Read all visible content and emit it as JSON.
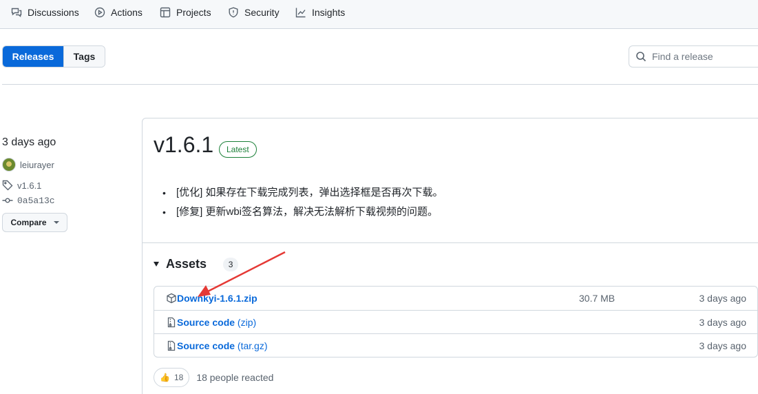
{
  "repo_nav": {
    "items": [
      {
        "label": "Discussions",
        "icon": "comment-discussion-icon"
      },
      {
        "label": "Actions",
        "icon": "play-icon"
      },
      {
        "label": "Projects",
        "icon": "table-icon"
      },
      {
        "label": "Security",
        "icon": "shield-icon"
      },
      {
        "label": "Insights",
        "icon": "graph-icon"
      }
    ]
  },
  "subnav": {
    "releases_label": "Releases",
    "tags_label": "Tags",
    "search_placeholder": "Find a release"
  },
  "sidebar": {
    "date": "3 days ago",
    "author": "leiurayer",
    "tag": "v1.6.1",
    "commit": "0a5a13c",
    "compare_label": "Compare"
  },
  "release": {
    "title": "v1.6.1",
    "badge": "Latest",
    "notes": [
      "[优化] 如果存在下载完成列表，弹出选择框是否再次下载。",
      "[修复] 更新wbi签名算法，解决无法解析下载视频的问题。"
    ],
    "assets_title": "Assets",
    "assets_count": "3",
    "assets": [
      {
        "name": "Downkyi-1.6.1.zip",
        "ext": "",
        "size": "30.7 MB",
        "time": "3 days ago",
        "icon": "package-icon"
      },
      {
        "name": "Source code",
        "ext": "(zip)",
        "size": "",
        "time": "3 days ago",
        "icon": "file-zip-icon"
      },
      {
        "name": "Source code",
        "ext": "(tar.gz)",
        "size": "",
        "time": "3 days ago",
        "icon": "file-zip-icon"
      }
    ],
    "reaction_emoji": "👍",
    "reaction_count": "18",
    "reaction_text": "18 people reacted"
  },
  "colors": {
    "accent": "#0969da",
    "latest_green": "#1a7f37",
    "annotation_arrow": "#e53935"
  }
}
